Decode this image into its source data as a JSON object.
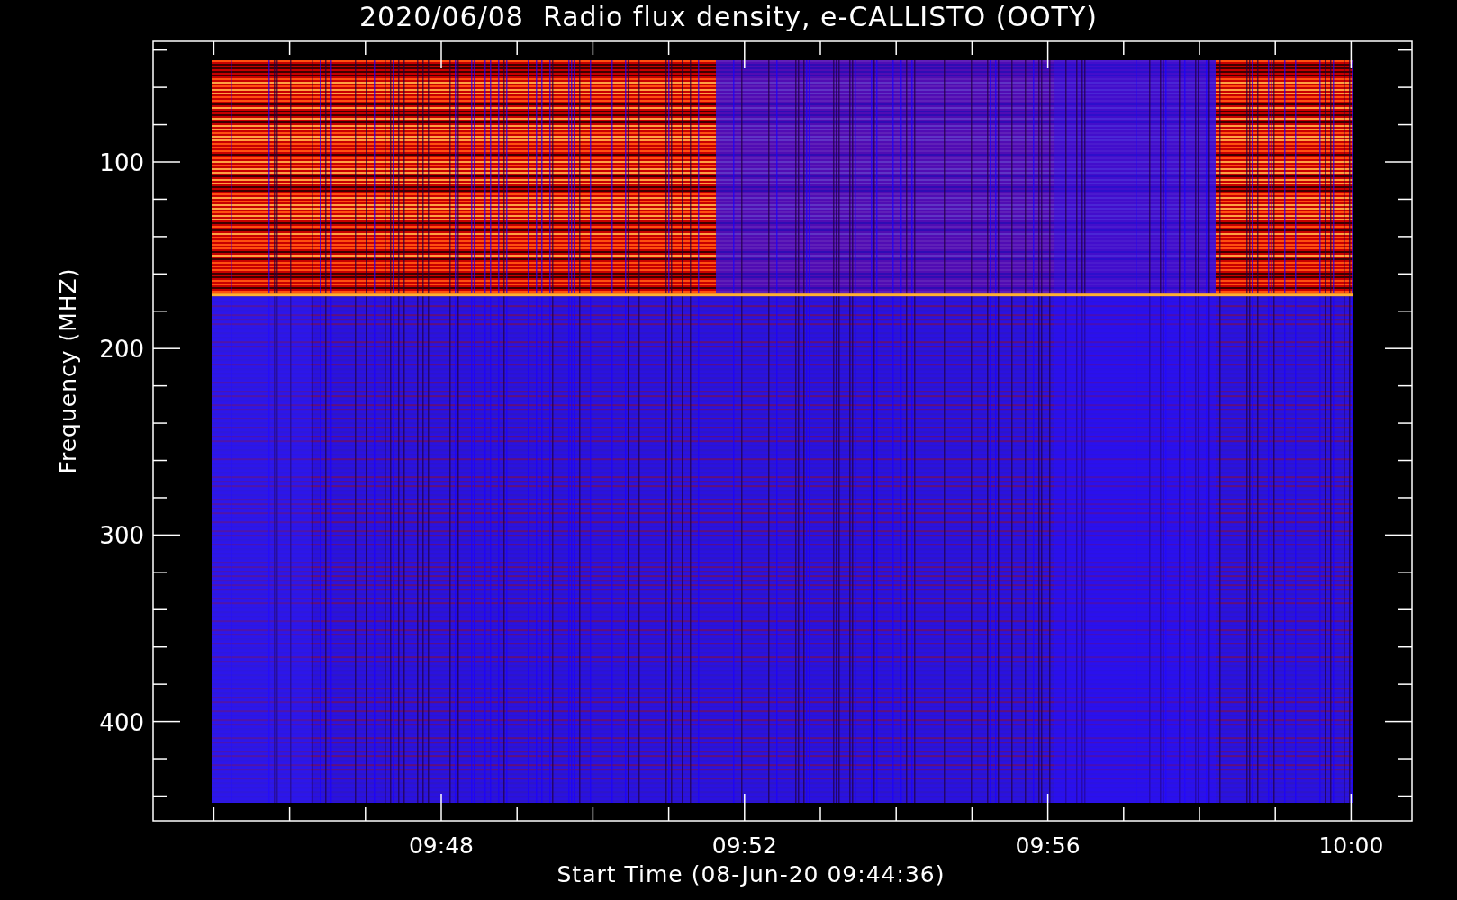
{
  "title": "2020/06/08  Radio flux density, e-CALLISTO (OOTY)",
  "y_axis": {
    "label": "Frequency (MHZ)",
    "ticks": [
      "100",
      "200",
      "300",
      "400"
    ]
  },
  "x_axis": {
    "label": "Start Time (08-Jun-20 09:44:36)",
    "ticks": [
      "09:48",
      "09:52",
      "09:56",
      "10:00"
    ]
  }
}
